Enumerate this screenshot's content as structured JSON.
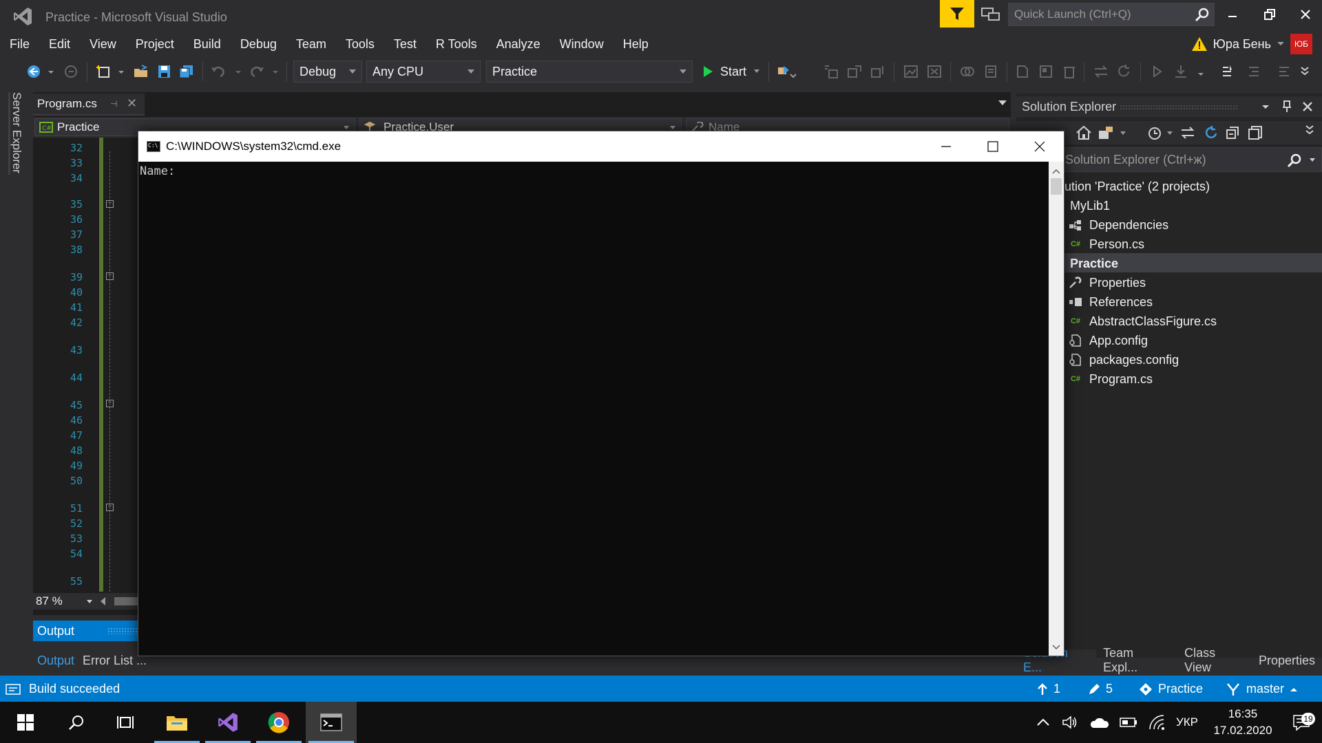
{
  "window": {
    "title": "Practice - Microsoft Visual Studio"
  },
  "quick_launch": {
    "placeholder": "Quick Launch (Ctrl+Q)"
  },
  "menu": [
    "File",
    "Edit",
    "View",
    "Project",
    "Build",
    "Debug",
    "Team",
    "Tools",
    "Test",
    "R Tools",
    "Analyze",
    "Window",
    "Help"
  ],
  "user": {
    "name": "Юра Бень",
    "initials": "ЮБ"
  },
  "toolbar": {
    "config": "Debug",
    "platform": "Any CPU",
    "startup_project": "Practice",
    "start_label": "Start"
  },
  "left_tab": {
    "label": "Server Explorer"
  },
  "editor": {
    "tab_title": "Program.cs",
    "nav_project": "Practice",
    "nav_class": "Practice.User",
    "nav_member": "Name",
    "line_numbers": [
      "32",
      "33",
      "34",
      "35",
      "36",
      "37",
      "38",
      "39",
      "40",
      "41",
      "42",
      "43",
      "44",
      "45",
      "46",
      "47",
      "48",
      "49",
      "50",
      "51",
      "52",
      "53",
      "54",
      "55"
    ],
    "zoom": "87 %"
  },
  "output": {
    "header": "Output",
    "tabs": [
      "Output",
      "Error List ..."
    ]
  },
  "solution_explorer": {
    "title": "Solution Explorer",
    "search_placeholder": "Solution Explorer (Ctrl+ж)",
    "items": [
      {
        "label": "lution 'Practice' (2 projects)",
        "icon": "solution-icon"
      },
      {
        "label": "MyLib1",
        "icon": "project-icon"
      },
      {
        "label": "Dependencies",
        "icon": "dependencies-icon"
      },
      {
        "label": "Person.cs",
        "icon": "csharp-file-icon"
      },
      {
        "label": "Practice",
        "icon": "project-icon"
      },
      {
        "label": "Properties",
        "icon": "wrench-icon"
      },
      {
        "label": "References",
        "icon": "references-icon"
      },
      {
        "label": "AbstractClassFigure.cs",
        "icon": "csharp-file-icon"
      },
      {
        "label": "App.config",
        "icon": "config-file-icon"
      },
      {
        "label": "packages.config",
        "icon": "config-file-icon"
      },
      {
        "label": "Program.cs",
        "icon": "csharp-file-icon"
      }
    ],
    "bottom_tabs": [
      "Solution E...",
      "Team Expl...",
      "Class View",
      "Properties"
    ]
  },
  "cmd": {
    "title": "C:\\WINDOWS\\system32\\cmd.exe",
    "output": "Name:"
  },
  "status": {
    "text": "Build succeeded",
    "up_count": "1",
    "edit_count": "5",
    "repo": "Practice",
    "branch": "master"
  },
  "taskbar": {
    "lang": "УКР",
    "time": "16:35",
    "date": "17.02.2020",
    "notifications": "19"
  },
  "colors": {
    "accent": "#007acc",
    "filter": "#ffcc00",
    "avatar": "#cc1f1f"
  }
}
